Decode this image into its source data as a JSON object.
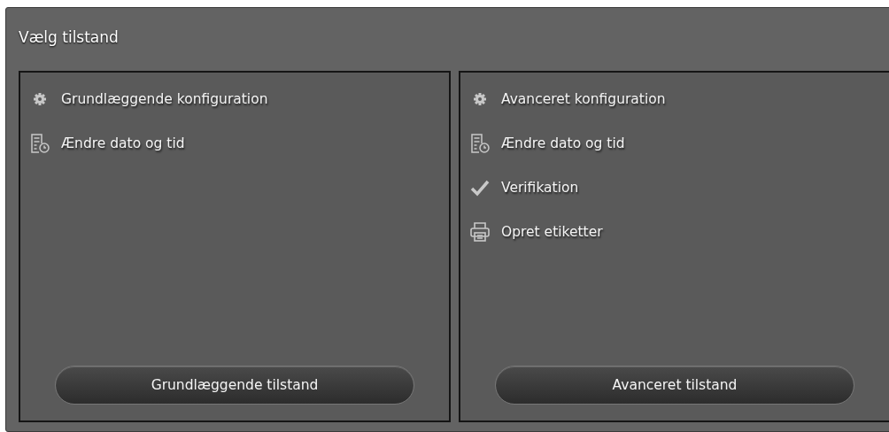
{
  "title": "Vælg tilstand",
  "panels": [
    {
      "items": [
        {
          "kind": "gear",
          "label": "Grundlæggende konfiguration"
        },
        {
          "kind": "calendar-clock",
          "label": "Ændre dato og tid"
        }
      ],
      "button": "Grundlæggende tilstand"
    },
    {
      "items": [
        {
          "kind": "gear",
          "label": "Avanceret konfiguration"
        },
        {
          "kind": "calendar-clock",
          "label": "Ændre dato og tid"
        },
        {
          "kind": "check",
          "label": "Verifikation"
        },
        {
          "kind": "printer",
          "label": "Opret etiketter"
        }
      ],
      "button": "Avanceret tilstand"
    }
  ]
}
